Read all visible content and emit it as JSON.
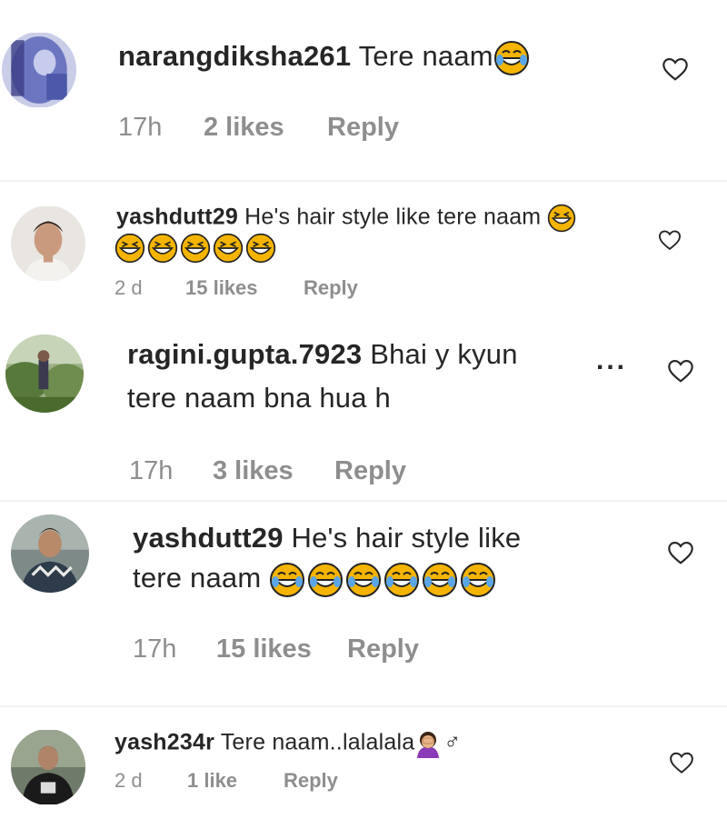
{
  "comments": [
    {
      "username": "narangdiksha261",
      "text": "Tere naam",
      "time": "17h",
      "likes": "2 likes",
      "reply": "Reply"
    },
    {
      "username": "yashdutt29",
      "text": "He's hair style like tere naam",
      "time": "2 d",
      "likes": "15 likes",
      "reply": "Reply"
    },
    {
      "username": "ragini.gupta.7923",
      "text": "Bhai y kyun",
      "text2": "tere naam bna hua h",
      "time": "17h",
      "likes": "3 likes",
      "reply": "Reply",
      "more": "..."
    },
    {
      "username": "yashdutt29",
      "text": "He's hair style like",
      "text2": "tere naam",
      "time": "17h",
      "likes": "15 likes",
      "reply": "Reply"
    },
    {
      "username": "yash234r",
      "text": "Tere naam..lalalala",
      "suffix": "♂",
      "time": "2 d",
      "likes": "1 like",
      "reply": "Reply"
    }
  ],
  "icons": {
    "like": "heart-outline-icon",
    "laugh": "grinning-squinting-face-emoji",
    "cry_laugh": "face-with-tears-of-joy-emoji",
    "facepalm": "woman-facepalming-emoji",
    "more": "more-options-icon"
  },
  "colors": {
    "text": "#262626",
    "meta": "#8e8e8e",
    "emoji": "#f4b400"
  }
}
